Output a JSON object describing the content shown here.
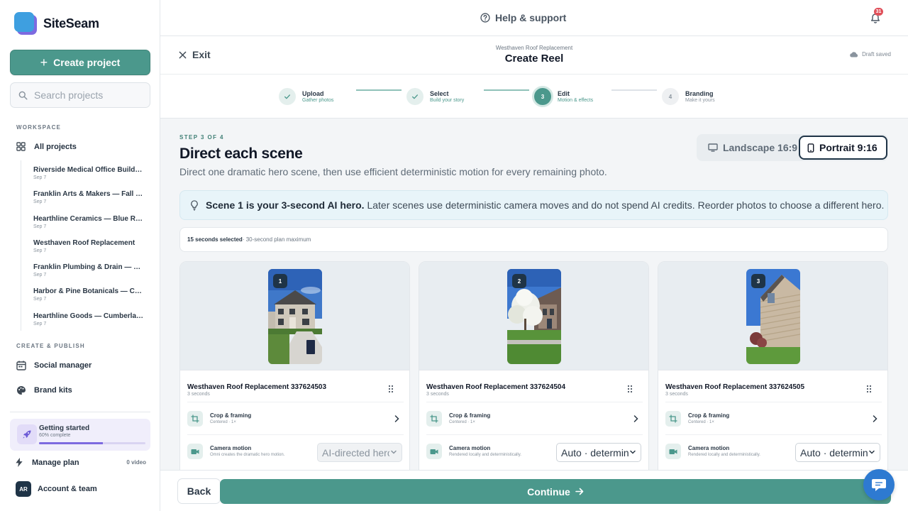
{
  "app": {
    "name": "SiteSeam"
  },
  "sidebar": {
    "create_label": "Create project",
    "search_placeholder": "Search projects",
    "workspace_label": "WORKSPACE",
    "all_projects": "All projects",
    "projects": [
      {
        "name": "Riverside Medical Office Buildout",
        "date": "Sep 7"
      },
      {
        "name": "Franklin Arts & Makers — Fall Ca…",
        "date": "Sep 7"
      },
      {
        "name": "Hearthline Ceramics — Blue Rid…",
        "date": "Sep 7"
      },
      {
        "name": "Westhaven Roof Replacement",
        "date": "Sep 7"
      },
      {
        "name": "Franklin Plumbing & Drain — Jo…",
        "date": "Sep 7"
      },
      {
        "name": "Harbor & Pine Botanicals — Coa…",
        "date": "Sep 7"
      },
      {
        "name": "Hearthline Goods — Cumberlan…",
        "date": "Sep 7"
      }
    ],
    "create_publish_label": "CREATE & PUBLISH",
    "social_manager": "Social manager",
    "brand_kits": "Brand kits",
    "getting_started": {
      "title": "Getting started",
      "subtitle": "60% complete",
      "progress": 0.6
    },
    "manage_plan": "Manage plan",
    "manage_plan_value": "0 video",
    "account": {
      "initials": "AR",
      "label": "Account & team"
    }
  },
  "topbar": {
    "help": "Help & support",
    "notifications": "31"
  },
  "header": {
    "exit": "Exit",
    "project": "Westhaven Roof Replacement",
    "title": "Create Reel",
    "draft": "Draft saved"
  },
  "stepper": [
    {
      "n": "1",
      "title": "Upload",
      "sub": "Gather photos",
      "state": "done"
    },
    {
      "n": "2",
      "title": "Select",
      "sub": "Build your story",
      "state": "done"
    },
    {
      "n": "3",
      "title": "Edit",
      "sub": "Motion & effects",
      "state": "active"
    },
    {
      "n": "4",
      "title": "Branding",
      "sub": "Make it yours",
      "state": "todo"
    }
  ],
  "main": {
    "eyebrow": "STEP 3 OF 4",
    "title": "Direct each scene",
    "description": "Direct one dramatic hero scene, then use efficient deterministic motion for every remaining photo.",
    "orientation": {
      "landscape": "Landscape 16:9",
      "portrait": "Portrait 9:16",
      "selected": "portrait"
    },
    "tip_bold": "Scene 1 is your 3-second AI hero.",
    "tip_rest": " Later scenes use deterministic camera moves and do not spend AI credits. Reorder photos to choose a different hero.",
    "selected_bold": "15 seconds selected",
    "selected_rest": " · 30-second plan maximum"
  },
  "scenes": [
    {
      "n": "1",
      "title": "Westhaven Roof Replacement 337624503",
      "duration": "3 seconds",
      "crop_label": "Crop & framing",
      "crop_sub": "Centered · 1×",
      "camera_label": "Camera motion",
      "camera_sub": "Omni creates the dramatic hero motion.",
      "camera_value": "AI-directed hero",
      "disabled": true
    },
    {
      "n": "2",
      "title": "Westhaven Roof Replacement 337624504",
      "duration": "3 seconds",
      "crop_label": "Crop & framing",
      "crop_sub": "Centered · 1×",
      "camera_label": "Camera motion",
      "camera_sub": "Rendered locally and deterministically.",
      "camera_value": "Auto · deterministic",
      "disabled": false
    },
    {
      "n": "3",
      "title": "Westhaven Roof Replacement 337624505",
      "duration": "3 seconds",
      "crop_label": "Crop & framing",
      "crop_sub": "Centered · 1×",
      "camera_label": "Camera motion",
      "camera_sub": "Rendered locally and deterministically.",
      "camera_value": "Auto · deterministic",
      "disabled": false
    }
  ],
  "footer": {
    "back": "Back",
    "continue": "Continue"
  },
  "colors": {
    "accent": "#4b988c",
    "navy": "#1f3447",
    "notification": "#e0505a",
    "chat": "#2e7ad1"
  }
}
